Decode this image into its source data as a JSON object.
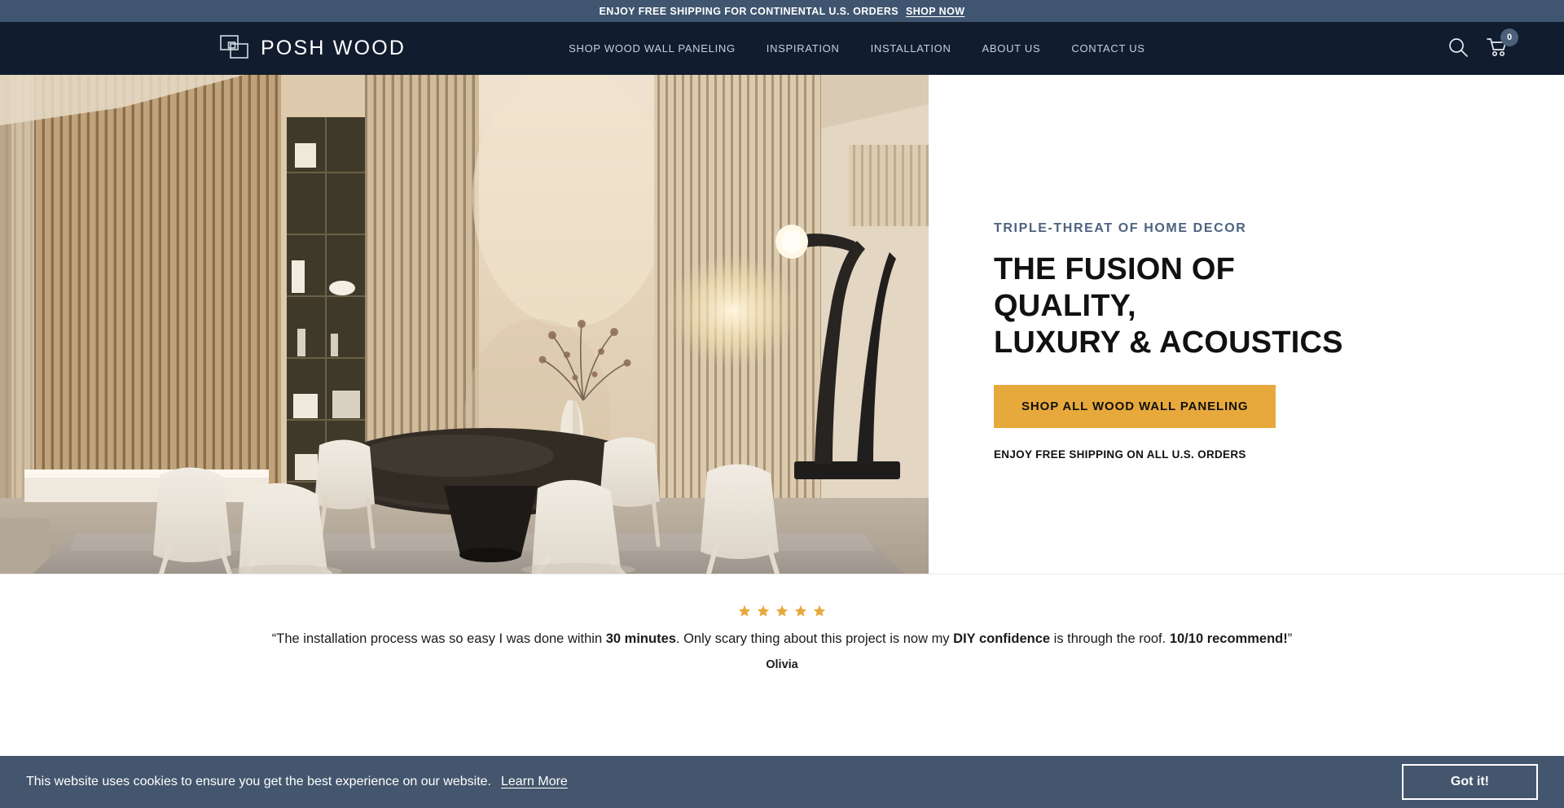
{
  "announcement": {
    "text": "ENJOY FREE SHIPPING FOR CONTINENTAL U.S. ORDERS",
    "link_label": "SHOP NOW",
    "background": "#3f5570"
  },
  "header": {
    "logo_text": "POSH WOOD",
    "logo_icon": "overlapping-squares-icon",
    "background": "#111d2e",
    "nav_items": [
      {
        "label": "SHOP WOOD WALL PANELING"
      },
      {
        "label": "INSPIRATION"
      },
      {
        "label": "INSTALLATION"
      },
      {
        "label": "ABOUT US"
      },
      {
        "label": "CONTACT US"
      }
    ],
    "search_icon": "search-icon",
    "cart_icon": "shopping-cart-icon",
    "cart_count": "0"
  },
  "hero": {
    "eyebrow": "TRIPLE-THREAT OF HOME DECOR",
    "headline_line1": "THE FUSION OF QUALITY,",
    "headline_line2": "LUXURY & ACOUSTICS",
    "cta_label": "SHOP ALL WOOD WALL PANELING",
    "cta_color": "#e8a93c",
    "sub_note": "ENJOY FREE SHIPPING ON ALL U.S. ORDERS",
    "image_alt": "Modern dining room with vertical wood slat wall paneling, round black table, cream chairs and a tall dark sculptural floor lamp"
  },
  "review": {
    "rating": 5,
    "star_color": "#e8a93c",
    "quote_part1": "“The installation process was so easy I was done within ",
    "quote_bold1": "30 minutes",
    "quote_part2": ". Only scary thing about this project is now my ",
    "quote_bold2": "DIY confidence",
    "quote_part3": " is through the roof. ",
    "quote_bold3": "10/10 recommend!",
    "quote_part4": "”",
    "author": "Olivia"
  },
  "cookie_banner": {
    "message": "This website uses cookies to ensure you get the best experience on our website.",
    "link_label": "Learn More",
    "accept_label": "Got it!",
    "background": "#44566d"
  }
}
